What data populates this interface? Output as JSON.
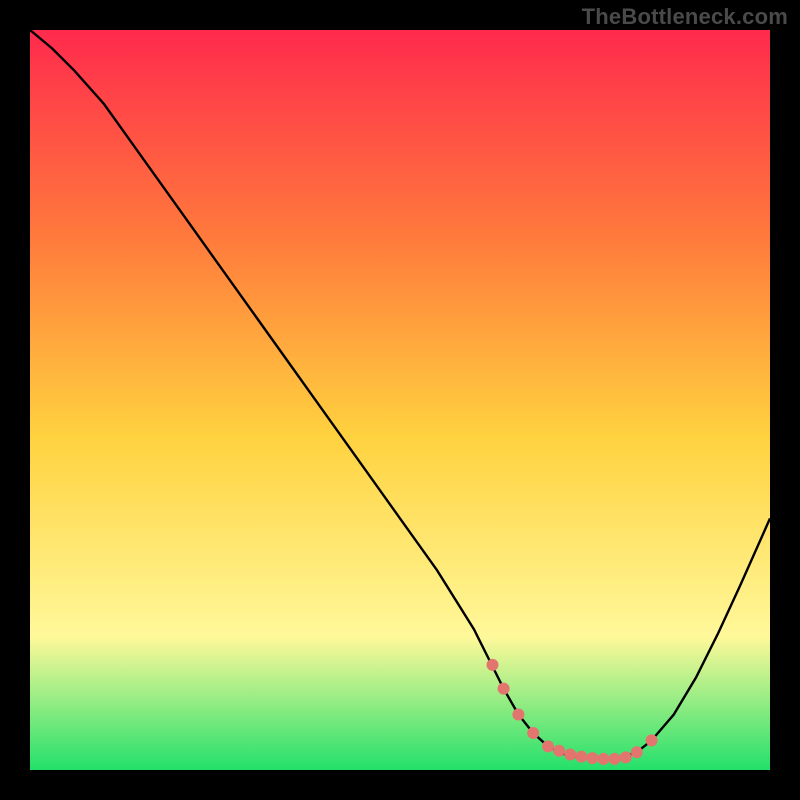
{
  "watermark": "TheBottleneck.com",
  "colors": {
    "bg": "#000000",
    "gradient_top": "#ff2a4d",
    "gradient_mid_upper": "#ff7a3c",
    "gradient_mid": "#ffd23f",
    "gradient_lower": "#fff89a",
    "gradient_bottom": "#23e06b",
    "curve_stroke": "#000000",
    "marker_fill": "#e2766f",
    "marker_stroke": "#e2766f"
  },
  "chart_data": {
    "type": "line",
    "title": "",
    "xlabel": "",
    "ylabel": "",
    "xlim": [
      0,
      100
    ],
    "ylim": [
      0,
      100
    ],
    "grid": false,
    "legend": false,
    "series": [
      {
        "name": "bottleneck-curve",
        "x": [
          0,
          3,
          6,
          10,
          15,
          20,
          25,
          30,
          35,
          40,
          45,
          50,
          55,
          60,
          62,
          64,
          66,
          68,
          70,
          72,
          74,
          76,
          78,
          80,
          82,
          84,
          87,
          90,
          93,
          96,
          100
        ],
        "y": [
          100,
          97.5,
          94.5,
          90,
          83,
          76,
          69,
          62,
          55,
          48,
          41,
          34,
          27,
          19,
          15,
          11,
          7.5,
          5,
          3.2,
          2.2,
          1.7,
          1.5,
          1.5,
          1.7,
          2.4,
          4,
          7.5,
          12.5,
          18.5,
          25,
          34
        ]
      }
    ],
    "markers": {
      "name": "highlighted-minimum",
      "x": [
        62.5,
        64,
        66,
        68,
        70,
        71.5,
        73,
        74.5,
        76,
        77.5,
        79,
        80.5,
        82,
        84
      ],
      "y": [
        14.2,
        11,
        7.5,
        5,
        3.2,
        2.6,
        2.1,
        1.8,
        1.6,
        1.5,
        1.5,
        1.7,
        2.4,
        4
      ]
    }
  }
}
